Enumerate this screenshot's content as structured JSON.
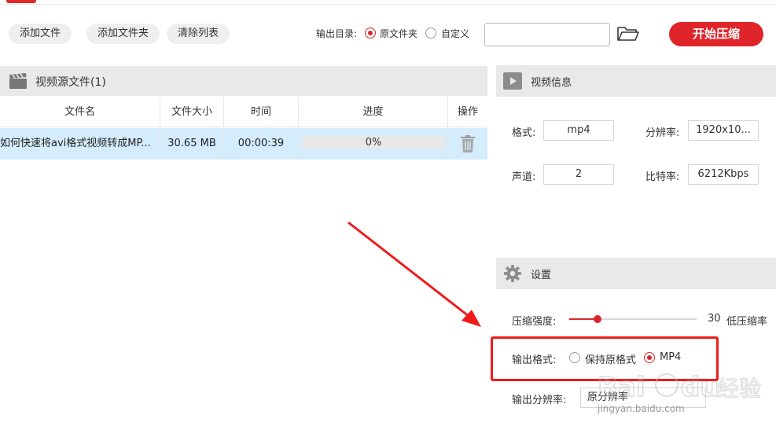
{
  "toolbar": {
    "add_file": "添加文件",
    "add_folder": "添加文件夹",
    "clear_list": "清除列表",
    "output_dir_label": "输出目录:",
    "output_option_original": "原文件夹",
    "output_option_custom": "自定义",
    "output_selected": "原文件夹",
    "path_value": "",
    "start_button": "开始压缩"
  },
  "source_panel": {
    "title": "视频源文件(1)",
    "columns": [
      "文件名",
      "文件大小",
      "时间",
      "进度",
      "操作"
    ],
    "rows": [
      {
        "filename": "如何快速将avi格式视频转成MP...",
        "size": "30.65 MB",
        "duration": "00:00:39",
        "progress_text": "0%",
        "progress": 0
      }
    ]
  },
  "video_info": {
    "title": "视频信息",
    "format_label": "格式:",
    "format_value": "mp4",
    "resolution_label": "分辨率:",
    "resolution_value": "1920x10...",
    "channel_label": "声道:",
    "channel_value": "2",
    "bitrate_label": "比特率:",
    "bitrate_value": "6212Kbps"
  },
  "settings": {
    "title": "设置",
    "compression_label": "压缩强度:",
    "compression_value": "30",
    "compression_level": 0.3,
    "compression_hint": "低压缩率",
    "output_format_label": "输出格式:",
    "format_keep": "保持原格式",
    "format_mp4": "MP4",
    "format_selected": "MP4",
    "output_resolution_label": "输出分辨率:",
    "output_resolution_value": "原分辨率"
  },
  "watermark": {
    "text": "jingyan.baidu.com"
  },
  "colors": {
    "accent": "#e0252a",
    "row_selected": "#d4ecfb",
    "header_bg": "#e9e9e9",
    "annotation": "#ee1c1c"
  }
}
